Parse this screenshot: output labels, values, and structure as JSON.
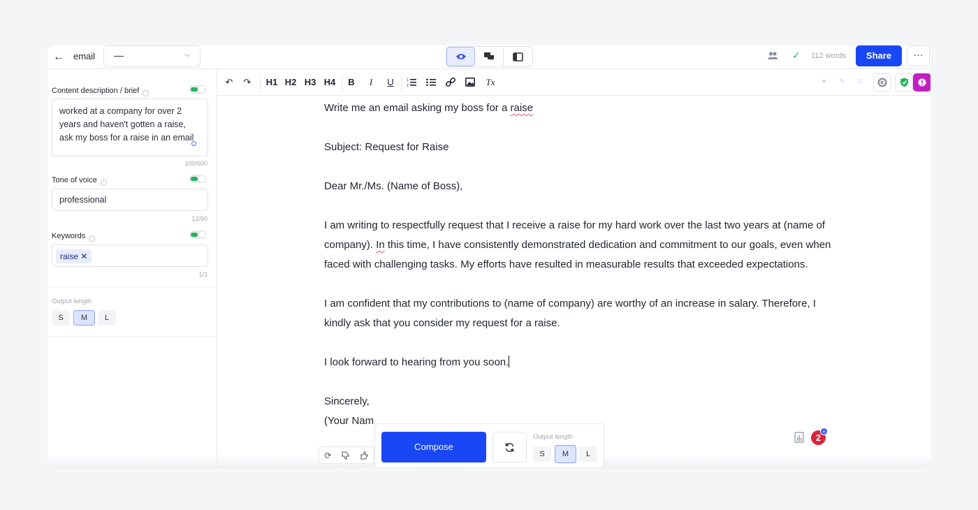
{
  "header": {
    "doc_name": "email",
    "template_select": "—",
    "word_count": "112 words",
    "share_label": "Share",
    "more_label": "···"
  },
  "sidebar": {
    "brief": {
      "label": "Content description / brief",
      "text": "worked at a company for over 2 years and haven't gotten a raise, ask my boss for a raise in an email",
      "counter": "100/600"
    },
    "tone": {
      "label": "Tone of voice",
      "value": "professional",
      "counter": "12/60"
    },
    "keywords": {
      "label": "Keywords",
      "chip": "raise",
      "chip_remove": "✕",
      "counter": "1/3"
    },
    "output_length": {
      "label": "Output length",
      "options": [
        "S",
        "M",
        "L"
      ],
      "selected": "M"
    }
  },
  "toolbar": {
    "headings": [
      "H1",
      "H2",
      "H3",
      "H4"
    ],
    "bold": "B",
    "italic": "I",
    "underline": "U",
    "clear_format": "Tx"
  },
  "editor": {
    "prompt_line_prefix": "Write me an email asking my boss for a ",
    "prompt_line_word": "raise",
    "subject": "Subject: Request for Raise",
    "greeting": "Dear Mr./Ms. (Name of Boss),",
    "body1_a": "I am writing to respectfully request that I receive a raise for my hard work over the last two years at (name of company). ",
    "body1_in": "In",
    "body1_b": " this time, I have consistently demonstrated dedication and commitment to our goals, even when faced with challenging tasks. My efforts have resulted in measurable results that exceeded expectations.",
    "body2": "I am confident that my contributions to (name of company) are worthy of an increase in salary. Therefore, I kindly ask that you consider my request for a raise.",
    "body3": "I look forward to hearing from you soon.",
    "signoff": "Sincerely,",
    "signature": "(Your Nam"
  },
  "compose_panel": {
    "compose_label": "Compose",
    "output_length_label": "Output length",
    "options": [
      "S",
      "M",
      "L"
    ],
    "selected": "M"
  },
  "notifications": {
    "count": "2",
    "plus": "+"
  },
  "colors": {
    "accent": "#1a47f5",
    "success": "#23b35a",
    "badge": "#d7263d",
    "plagiarism": "#c21fc1"
  }
}
